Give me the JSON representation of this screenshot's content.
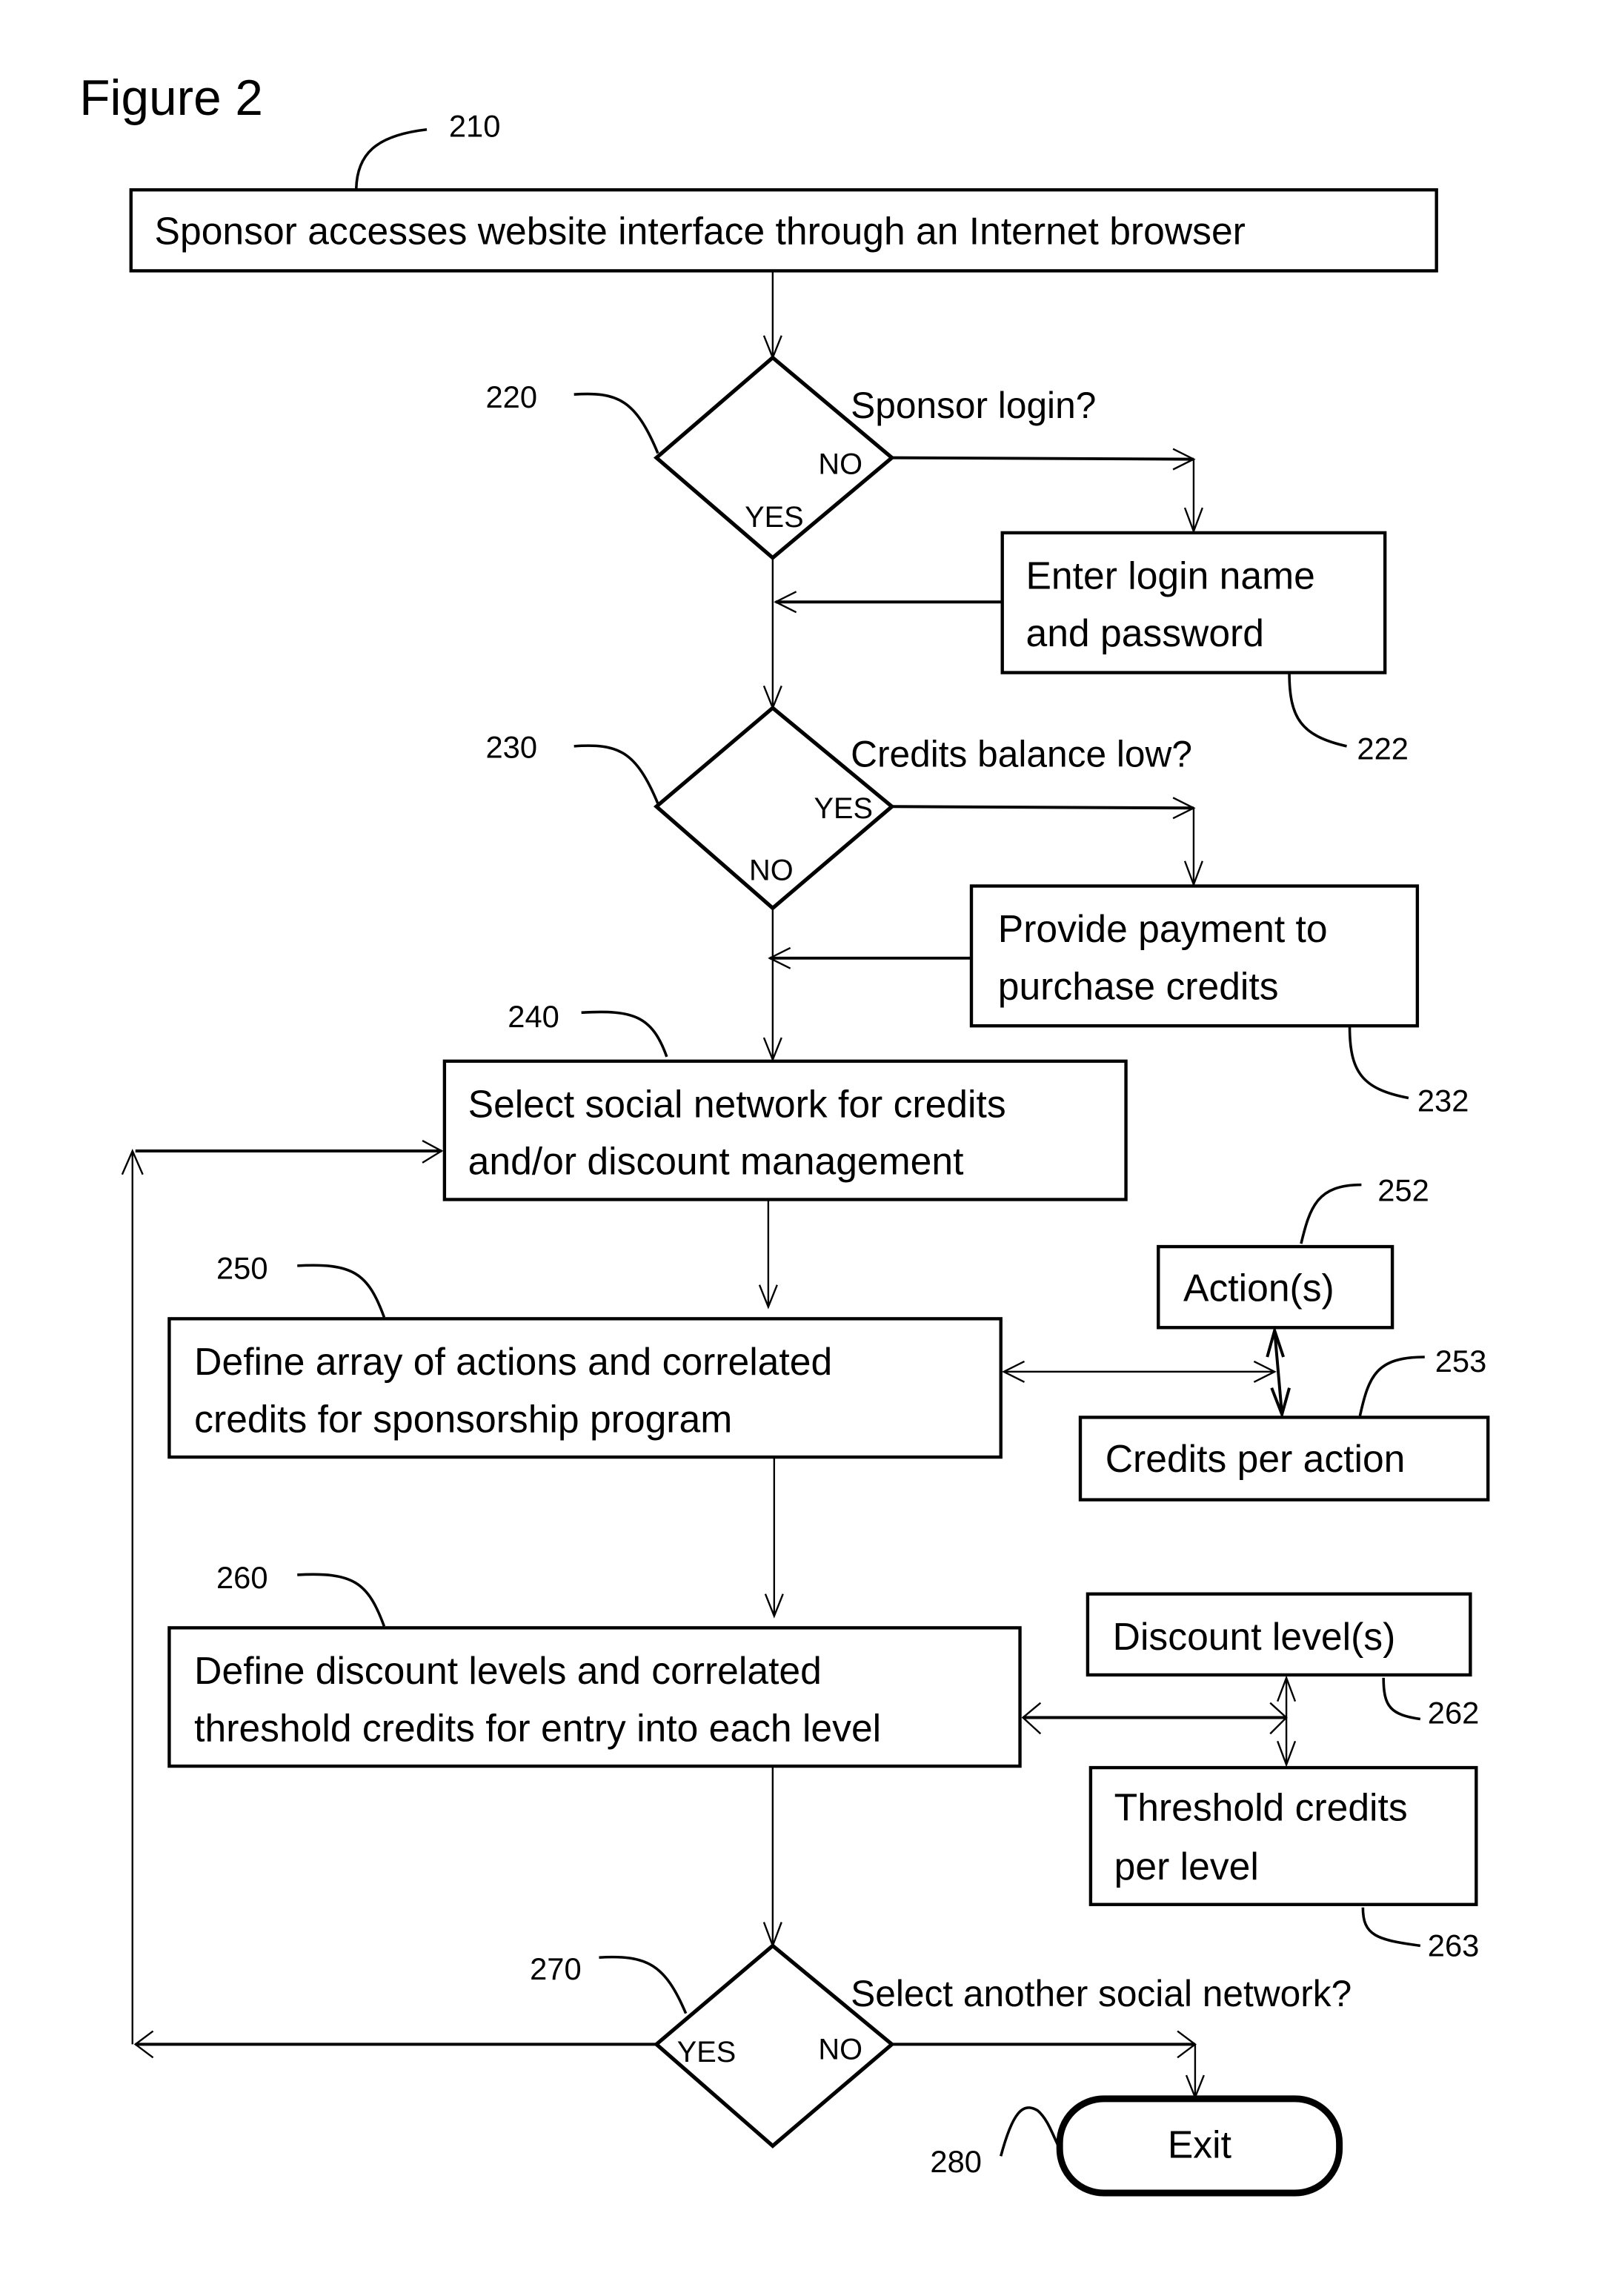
{
  "figure": {
    "title": "Figure 2"
  },
  "steps": {
    "s210": {
      "ref": "210",
      "text": [
        "Sponsor accesses website interface through an Internet browser"
      ]
    },
    "s220": {
      "ref": "220",
      "question": "Sponsor login?",
      "no": "NO",
      "yes": "YES"
    },
    "s222": {
      "ref": "222",
      "text": [
        "Enter login name",
        "and password"
      ]
    },
    "s230": {
      "ref": "230",
      "question": "Credits balance low?",
      "yes": "YES",
      "no": "NO"
    },
    "s232": {
      "ref": "232",
      "text": [
        "Provide payment to",
        "purchase credits"
      ]
    },
    "s240": {
      "ref": "240",
      "text": [
        "Select social network for credits",
        "and/or discount management"
      ]
    },
    "s250": {
      "ref": "250",
      "text": [
        "Define array of actions and correlated",
        "credits for  sponsorship program"
      ]
    },
    "s252": {
      "ref": "252",
      "text": [
        "Action(s)"
      ]
    },
    "s253": {
      "ref": "253",
      "text": [
        "Credits per action"
      ]
    },
    "s260": {
      "ref": "260",
      "text": [
        "Define discount levels and correlated",
        "threshold credits for entry into each level"
      ]
    },
    "s262": {
      "ref": "262",
      "text": [
        "Discount level(s)"
      ]
    },
    "s263": {
      "ref": "263",
      "text": [
        "Threshold credits",
        " per level"
      ]
    },
    "s270": {
      "ref": "270",
      "question": "Select another social network?",
      "yes": "YES",
      "no": "NO"
    },
    "s280": {
      "ref": "280",
      "text": [
        "Exit"
      ]
    }
  }
}
